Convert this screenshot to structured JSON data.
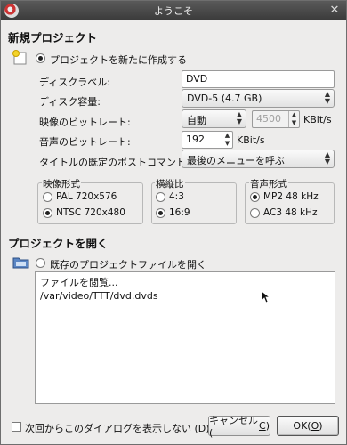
{
  "window": {
    "title": "ようこそ"
  },
  "new_project": {
    "header": "新規プロジェクト",
    "create_radio_label": "プロジェクトを新たに作成する",
    "create_selected": true,
    "disc_label": {
      "label": "ディスクラベル:",
      "value": "DVD"
    },
    "disc_capacity": {
      "label": "ディスク容量:",
      "value": "DVD-5 (4.7 GB)"
    },
    "video_bitrate": {
      "label": "映像のビットレート:",
      "mode": "自動",
      "value": "4500",
      "unit": "KBit/s"
    },
    "audio_bitrate": {
      "label": "音声のビットレート:",
      "value": "192",
      "unit": "KBit/s"
    },
    "post_command": {
      "label": "タイトルの既定のポストコマンド:",
      "value": "最後のメニューを呼ぶ"
    },
    "video_format": {
      "title": "映像形式",
      "options": [
        "PAL 720x576",
        "NTSC 720x480"
      ],
      "selected": 1
    },
    "aspect_ratio": {
      "title": "横縦比",
      "options": [
        "4:3",
        "16:9"
      ],
      "selected": 1
    },
    "audio_format": {
      "title": "音声形式",
      "options": [
        "MP2 48 kHz",
        "AC3 48 kHz"
      ],
      "selected": 0
    }
  },
  "open_project": {
    "header": "プロジェクトを開く",
    "open_radio_label": "既存のプロジェクトファイルを開く",
    "open_selected": false,
    "files": [
      "ファイルを閲覧...",
      "/var/video/TTT/dvd.dvds"
    ]
  },
  "footer": {
    "dont_show_label": "次回からこのダイアログを表示しない (",
    "dont_show_mnemonic": "D",
    "dont_show_close": ")",
    "dont_show_checked": false,
    "cancel_label": "キャンセル(",
    "cancel_mnemonic": "C",
    "cancel_close": ")",
    "ok_label": "OK(",
    "ok_mnemonic": "O",
    "ok_close": ")"
  },
  "colors": {
    "titlebar": "#3f3f3f",
    "background": "#edeceb"
  },
  "icons": [
    "dvd-app-icon",
    "close-icon",
    "new-project-icon",
    "open-folder-icon",
    "mouse-cursor"
  ]
}
